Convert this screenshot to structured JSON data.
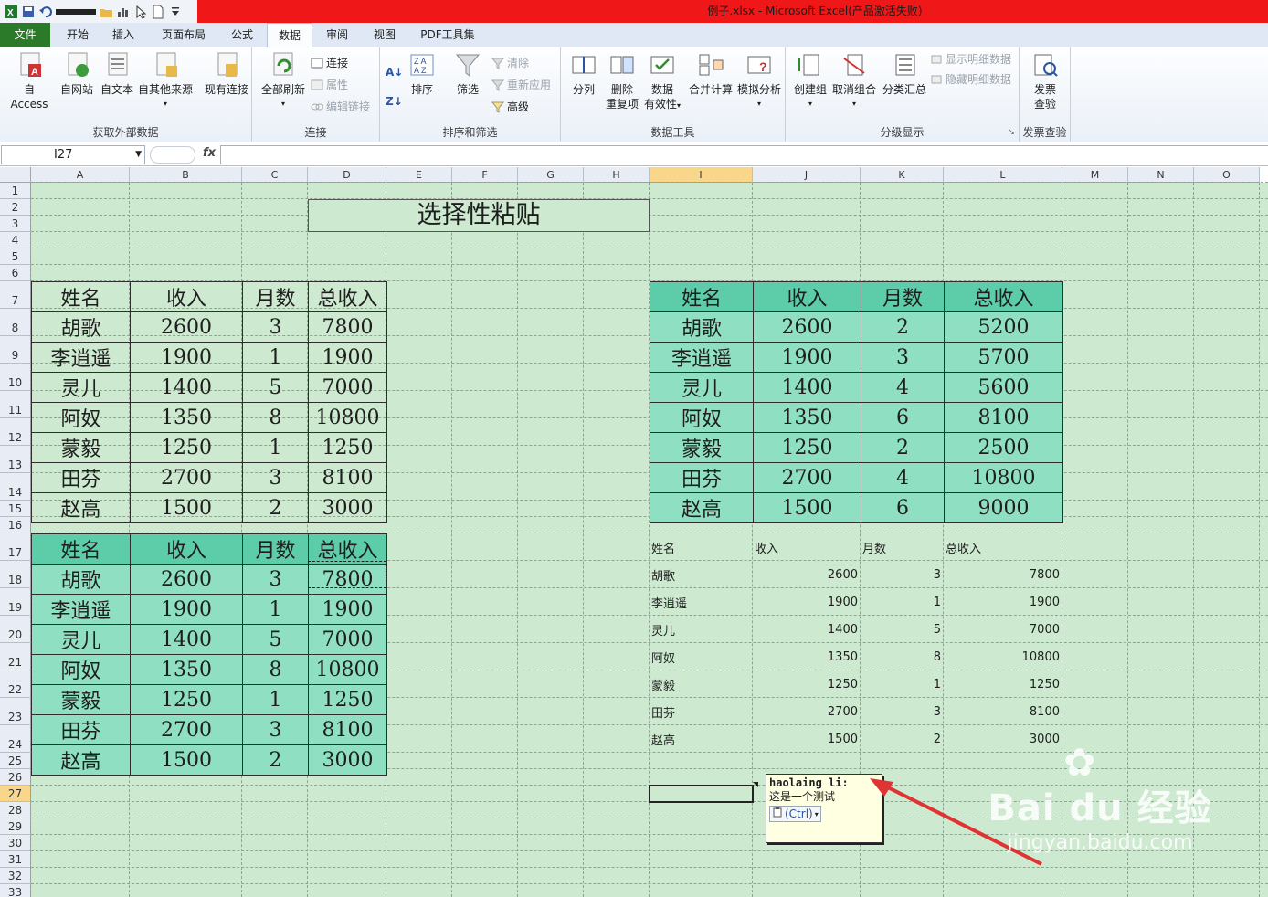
{
  "window": {
    "title": "例子.xlsx - Microsoft Excel(产品激活失败)"
  },
  "tabs": [
    {
      "label": "文件"
    },
    {
      "label": "开始"
    },
    {
      "label": "插入"
    },
    {
      "label": "页面布局"
    },
    {
      "label": "公式"
    },
    {
      "label": "数据"
    },
    {
      "label": "审阅"
    },
    {
      "label": "视图"
    },
    {
      "label": "PDF工具集"
    }
  ],
  "ribbon": {
    "get_external": {
      "label": "获取外部数据",
      "access": "自 Access",
      "web": "自网站",
      "text": "自文本",
      "other": "自其他来源",
      "existing": "现有连接"
    },
    "connections": {
      "label": "连接",
      "refresh_all": "全部刷新",
      "connections": "连接",
      "properties": "属性",
      "edit_links": "编辑链接"
    },
    "sort_filter": {
      "label": "排序和筛选",
      "sort": "排序",
      "filter": "筛选",
      "clear": "清除",
      "reapply": "重新应用",
      "advanced": "高级"
    },
    "data_tools": {
      "label": "数据工具",
      "split": "分列",
      "remove_dup_1": "删除",
      "remove_dup_2": "重复项",
      "validation_1": "数据",
      "validation_2": "有效性",
      "consolidate": "合并计算",
      "whatif": "模拟分析"
    },
    "outline": {
      "label": "分级显示",
      "group": "创建组",
      "ungroup": "取消组合",
      "subtotal": "分类汇总",
      "show_detail": "显示明细数据",
      "hide_detail": "隐藏明细数据"
    },
    "invoice": {
      "label": "发票查验",
      "btn_1": "发票",
      "btn_2": "查验"
    }
  },
  "formula_bar": {
    "name_box": "I27",
    "fx": "fx",
    "value": ""
  },
  "columns": [
    "A",
    "B",
    "C",
    "D",
    "E",
    "F",
    "G",
    "H",
    "I",
    "J",
    "K",
    "L",
    "M",
    "N",
    "O"
  ],
  "rows": [
    "1",
    "2",
    "3",
    "4",
    "5",
    "6",
    "7",
    "8",
    "9",
    "10",
    "11",
    "12",
    "13",
    "14",
    "15",
    "16",
    "17",
    "18",
    "19",
    "20",
    "21",
    "22",
    "23",
    "24",
    "25",
    "26",
    "27",
    "28",
    "29",
    "30",
    "31",
    "32",
    "33"
  ],
  "sheet": {
    "title": "选择性粘贴",
    "headers": [
      "姓名",
      "收入",
      "月数",
      "总收入"
    ],
    "table_a": [
      [
        "胡歌",
        "2600",
        "3",
        "7800"
      ],
      [
        "李逍遥",
        "1900",
        "1",
        "1900"
      ],
      [
        "灵儿",
        "1400",
        "5",
        "7000"
      ],
      [
        "阿奴",
        "1350",
        "8",
        "10800"
      ],
      [
        "蒙毅",
        "1250",
        "1",
        "1250"
      ],
      [
        "田芬",
        "2700",
        "3",
        "8100"
      ],
      [
        "赵高",
        "1500",
        "2",
        "3000"
      ]
    ],
    "table_b": [
      [
        "胡歌",
        "2600",
        "2",
        "5200"
      ],
      [
        "李逍遥",
        "1900",
        "3",
        "5700"
      ],
      [
        "灵儿",
        "1400",
        "4",
        "5600"
      ],
      [
        "阿奴",
        "1350",
        "6",
        "8100"
      ],
      [
        "蒙毅",
        "1250",
        "2",
        "2500"
      ],
      [
        "田芬",
        "2700",
        "4",
        "10800"
      ],
      [
        "赵高",
        "1500",
        "6",
        "9000"
      ]
    ],
    "table_c": [
      [
        "胡歌",
        "2600",
        "3",
        "7800"
      ],
      [
        "李逍遥",
        "1900",
        "1",
        "1900"
      ],
      [
        "灵儿",
        "1400",
        "5",
        "7000"
      ],
      [
        "阿奴",
        "1350",
        "8",
        "10800"
      ],
      [
        "蒙毅",
        "1250",
        "1",
        "1250"
      ],
      [
        "田芬",
        "2700",
        "3",
        "8100"
      ],
      [
        "赵高",
        "1500",
        "2",
        "3000"
      ]
    ],
    "table_d": [
      [
        "胡歌",
        "2600",
        "3",
        "7800"
      ],
      [
        "李逍遥",
        "1900",
        "1",
        "1900"
      ],
      [
        "灵儿",
        "1400",
        "5",
        "7000"
      ],
      [
        "阿奴",
        "1350",
        "8",
        "10800"
      ],
      [
        "蒙毅",
        "1250",
        "1",
        "1250"
      ],
      [
        "田芬",
        "2700",
        "3",
        "8100"
      ],
      [
        "赵高",
        "1500",
        "2",
        "3000"
      ]
    ]
  },
  "comment": {
    "author": "haolaing li:",
    "text": "这是一个测试",
    "paste_ctrl": "(Ctrl)"
  },
  "watermark": {
    "brand": "Bai du 经验",
    "url": "jingyan.baidu.com"
  },
  "colors": {
    "sheet_bg": "#cde9d0",
    "header_teal": "#5ccda8",
    "body_teal": "#8fe0c3",
    "title_red": "#ef1717",
    "file_tab": "#2a7a2a"
  }
}
